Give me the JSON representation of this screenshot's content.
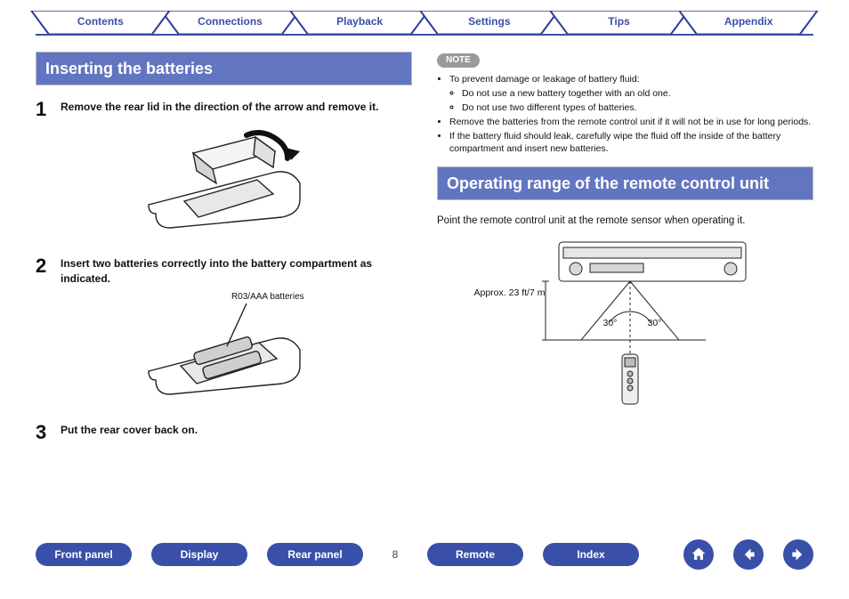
{
  "top_tabs": [
    "Contents",
    "Connections",
    "Playback",
    "Settings",
    "Tips",
    "Appendix"
  ],
  "left": {
    "heading": "Inserting the batteries",
    "steps": [
      {
        "num": "1",
        "text": "Remove the rear lid in the direction of the arrow and remove it."
      },
      {
        "num": "2",
        "text": "Insert two batteries correctly into the battery compartment as indicated."
      },
      {
        "num": "3",
        "text": "Put the rear cover back on."
      }
    ],
    "battery_spec": "R03/AAA batteries"
  },
  "right": {
    "note_label": "NOTE",
    "note_items": [
      "To prevent damage or leakage of battery fluid:",
      [
        "Do not use a new battery together with an old one.",
        "Do not use two different types of batteries."
      ],
      "Remove the batteries from the remote control unit if it will not be in use for long periods.",
      "If the battery fluid should leak, carefully wipe the fluid off the inside of the battery compartment and insert new batteries."
    ],
    "heading": "Operating range of the remote control unit",
    "intro": "Point the remote control unit at the remote sensor when operating it.",
    "range": "Approx. 23 ft/7 m",
    "angle_left": "30°",
    "angle_right": "30°"
  },
  "bottom": {
    "buttons": [
      "Front panel",
      "Display",
      "Rear panel"
    ],
    "page": "8",
    "buttons2": [
      "Remote",
      "Index"
    ],
    "home": "home-icon",
    "back": "back-icon",
    "forward": "forward-icon"
  }
}
